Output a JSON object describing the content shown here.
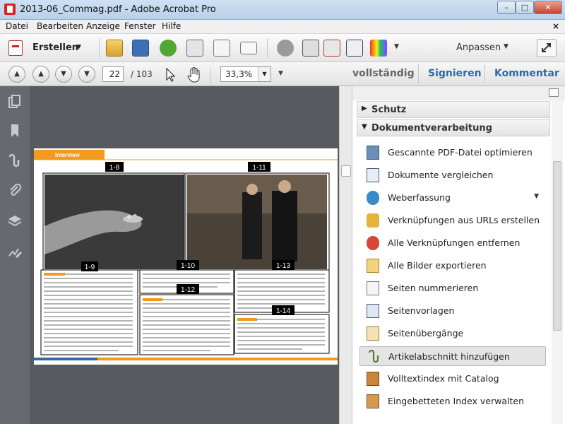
{
  "window": {
    "title": "2013-06_Commag.pdf - Adobe Acrobat Pro",
    "buttons": [
      "minimize",
      "maximize",
      "close"
    ]
  },
  "menu": {
    "items": [
      "Datei",
      "Bearbeiten",
      "Anzeige",
      "Fenster",
      "Hilfe"
    ],
    "close_glyph": "×"
  },
  "toolbar": {
    "create_label": "Erstellen",
    "customize_label": "Anpassen",
    "icons": [
      "open-folder-icon",
      "save-icon",
      "cloud-upload-icon",
      "print-icon",
      "edit-doc-icon",
      "email-icon",
      "gear-icon",
      "search-stamp-icon",
      "export-icon",
      "select-icon",
      "color-icon"
    ]
  },
  "nav": {
    "page_current": "22",
    "page_total": "/ 103",
    "zoom": "33,3%",
    "view_full": "vollständig",
    "sign": "Signieren",
    "comment": "Kommentar"
  },
  "page_labels": {
    "header": "Interview",
    "callouts": [
      "1-8",
      "1-11",
      "1-9",
      "1-10",
      "1-12",
      "1-13",
      "1-14"
    ]
  },
  "panel": {
    "collapsed_section": "Schutz",
    "expanded_section": "Dokumentverarbeitung",
    "items": [
      {
        "label": "Gescannte PDF-Datei optimieren",
        "icon": "scan-icon"
      },
      {
        "label": "Dokumente vergleichen",
        "icon": "compare-icon"
      },
      {
        "label": "Weberfassung",
        "icon": "globe-icon",
        "dropdown": true
      },
      {
        "label": "Verknüpfungen aus URLs erstellen",
        "icon": "link-create-icon"
      },
      {
        "label": "Alle Verknüpfungen entfernen",
        "icon": "link-remove-icon"
      },
      {
        "label": "Alle Bilder exportieren",
        "icon": "image-export-icon"
      },
      {
        "label": "Seiten nummerieren",
        "icon": "page-number-icon"
      },
      {
        "label": "Seitenvorlagen",
        "icon": "page-template-icon"
      },
      {
        "label": "Seitenübergänge",
        "icon": "page-transition-icon"
      },
      {
        "label": "Artikelabschnitt hinzufügen",
        "icon": "article-icon",
        "selected": true
      },
      {
        "label": "Volltextindex mit Catalog",
        "icon": "catalog-icon"
      },
      {
        "label": "Eingebetteten Index verwalten",
        "icon": "index-icon"
      }
    ]
  },
  "colors": {
    "accent_blue": "#2d6aa8",
    "page_header_orange": "#f39a1e",
    "label_black": "#000000"
  }
}
